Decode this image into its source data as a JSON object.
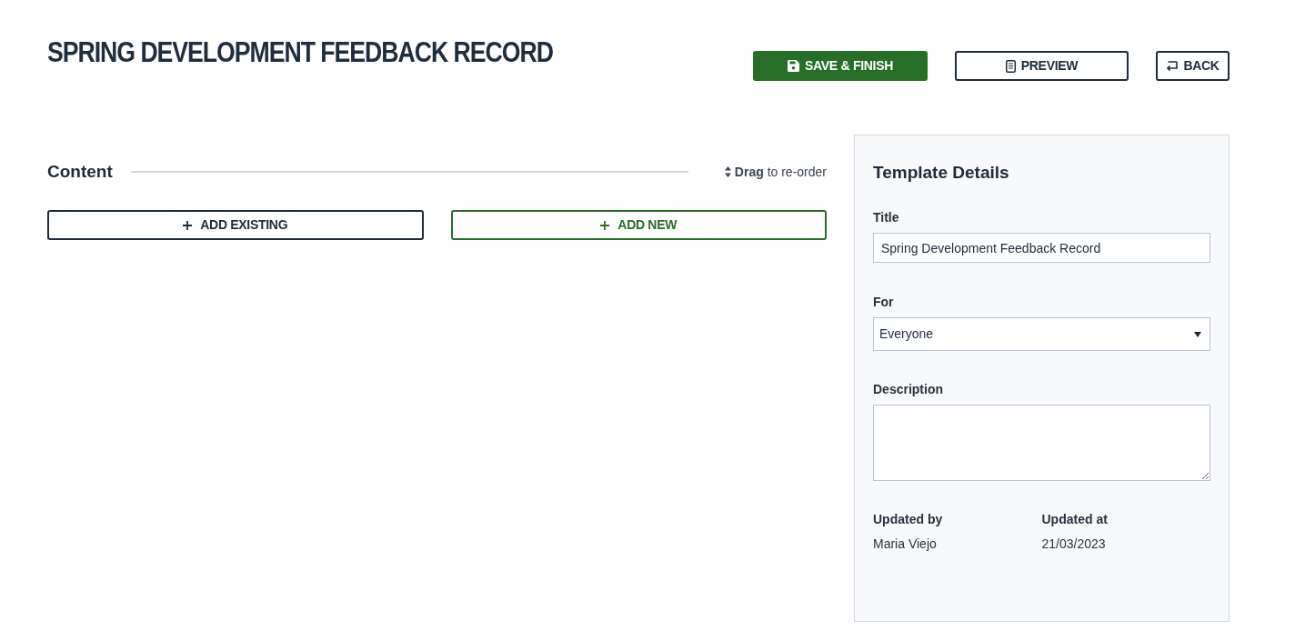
{
  "header": {
    "title": "SPRING DEVELOPMENT FEEDBACK RECORD",
    "actions": [
      {
        "label": "SAVE & FINISH",
        "kind": "primary"
      },
      {
        "label": "PREVIEW",
        "kind": "outline"
      },
      {
        "label": "BACK",
        "kind": "outline"
      }
    ]
  },
  "content": {
    "heading": "Content",
    "hint": "**Drag** to re-order",
    "buttons": [
      {
        "label": "ADD EXISTING",
        "kind": "neutral"
      },
      {
        "label": "ADD NEW",
        "kind": "success"
      }
    ]
  },
  "template_details": {
    "heading": "Template Details",
    "fields": [
      {
        "label": "Title",
        "kind": "text",
        "value": "Spring Development Feedback Record"
      },
      {
        "label": "For",
        "kind": "select",
        "value": "Everyone"
      },
      {
        "label": "Description",
        "kind": "textarea"
      }
    ],
    "meta": [
      {
        "label": "Updated by",
        "value": "Maria Viejo"
      },
      {
        "label": "Updated at",
        "value": "21/03/2023"
      }
    ]
  }
}
